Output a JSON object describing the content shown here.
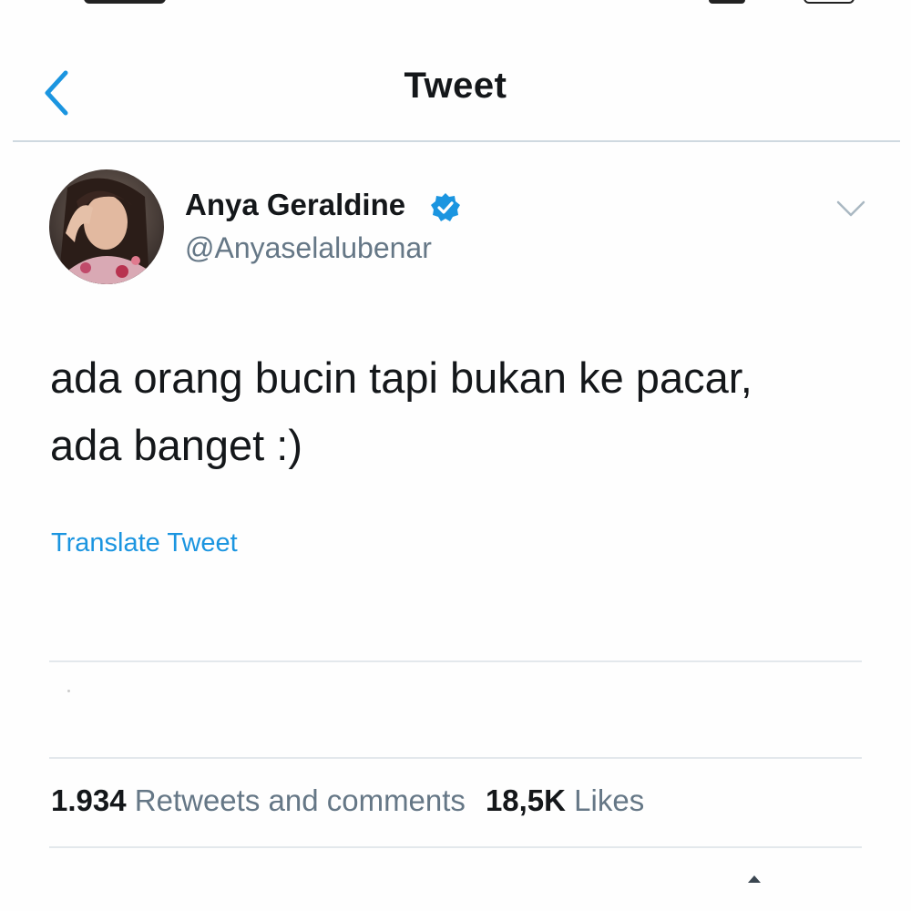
{
  "header": {
    "title": "Tweet",
    "back_icon": "chevron-left-icon"
  },
  "colors": {
    "accent": "#1b95e0",
    "text_primary": "#14171a",
    "text_secondary": "#657786",
    "divider": "#e3e8ec"
  },
  "author": {
    "name": "Anya Geraldine",
    "handle": "@Anyaselalubenar",
    "verified": true,
    "verified_icon": "verified-badge-icon",
    "avatar_icon": "avatar"
  },
  "tweet": {
    "line1": "ada orang bucin tapi bukan ke pacar,",
    "line2": "ada banget :)",
    "translate_label": "Translate Tweet"
  },
  "stats": {
    "retweets_count": "1.934",
    "retweets_label": "Retweets and comments",
    "likes_count": "18,5K",
    "likes_label": "Likes"
  }
}
